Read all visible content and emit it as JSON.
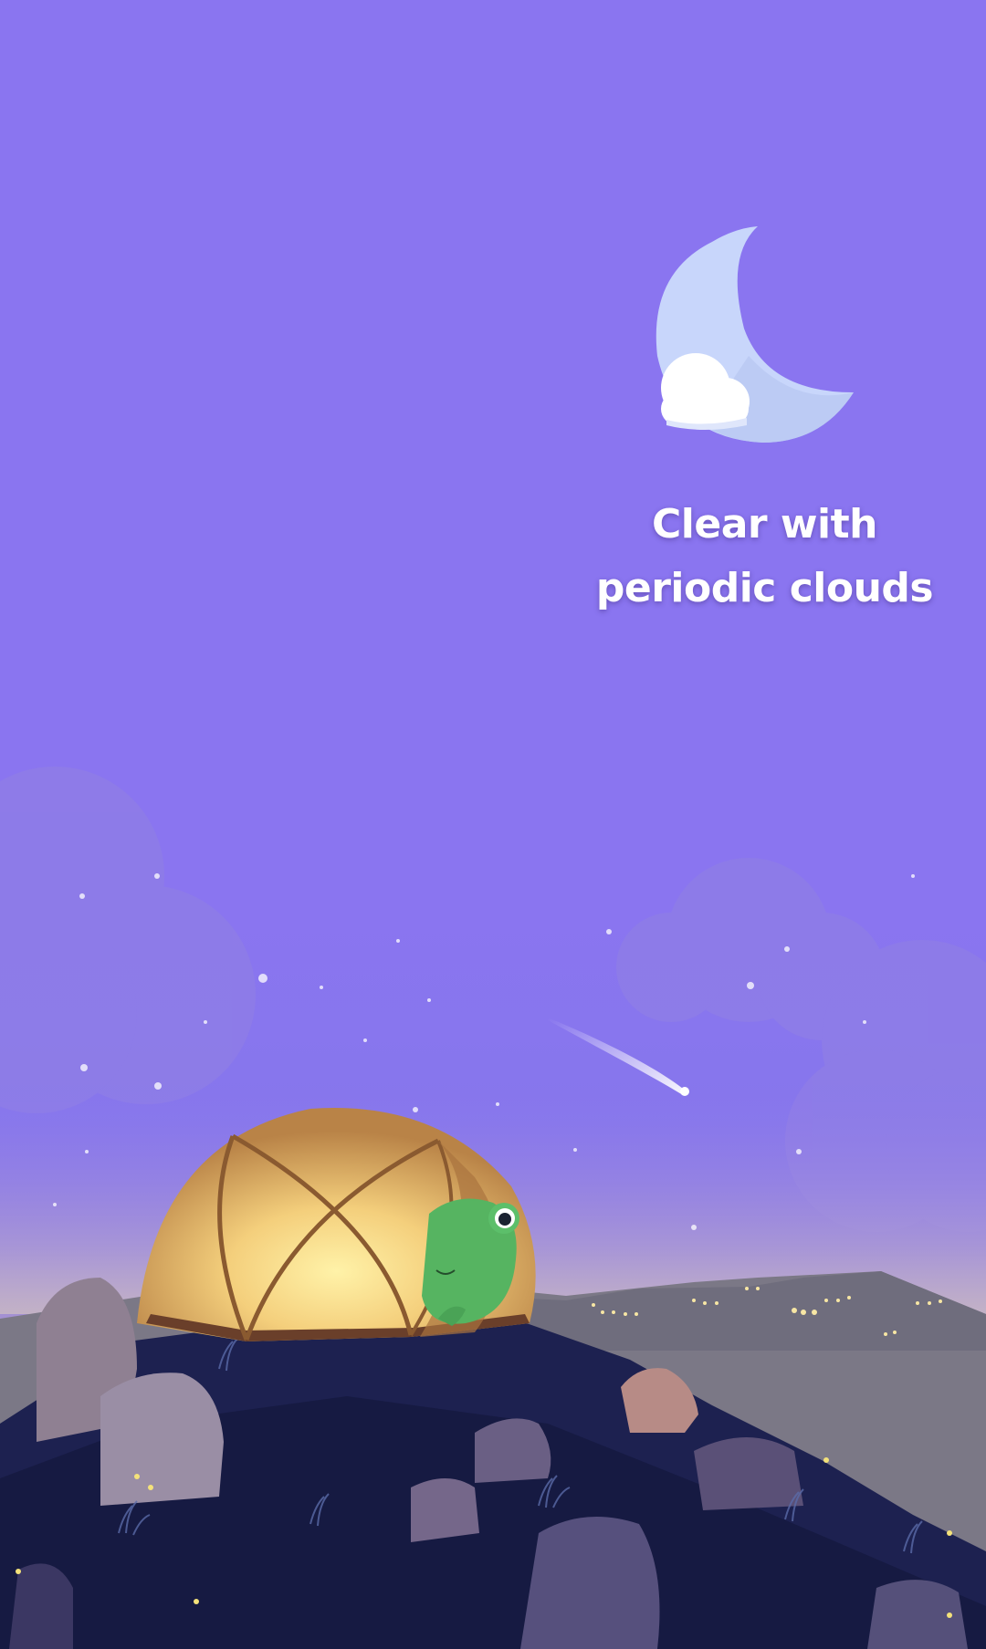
{
  "weather": {
    "condition_line1": "Clear with",
    "condition_line2": "periodic clouds",
    "icon": "moon-with-cloud-icon"
  },
  "scene": {
    "description_icon": "camping-scene-illustration"
  },
  "colors": {
    "sky": "#8a75f0",
    "moon": "#c9d6fb",
    "cloud": "#ffffff",
    "tent": "#e8b46a",
    "frog": "#4caf5c",
    "mountains": "#7d7a88",
    "rocks": "#1c1f4a"
  }
}
